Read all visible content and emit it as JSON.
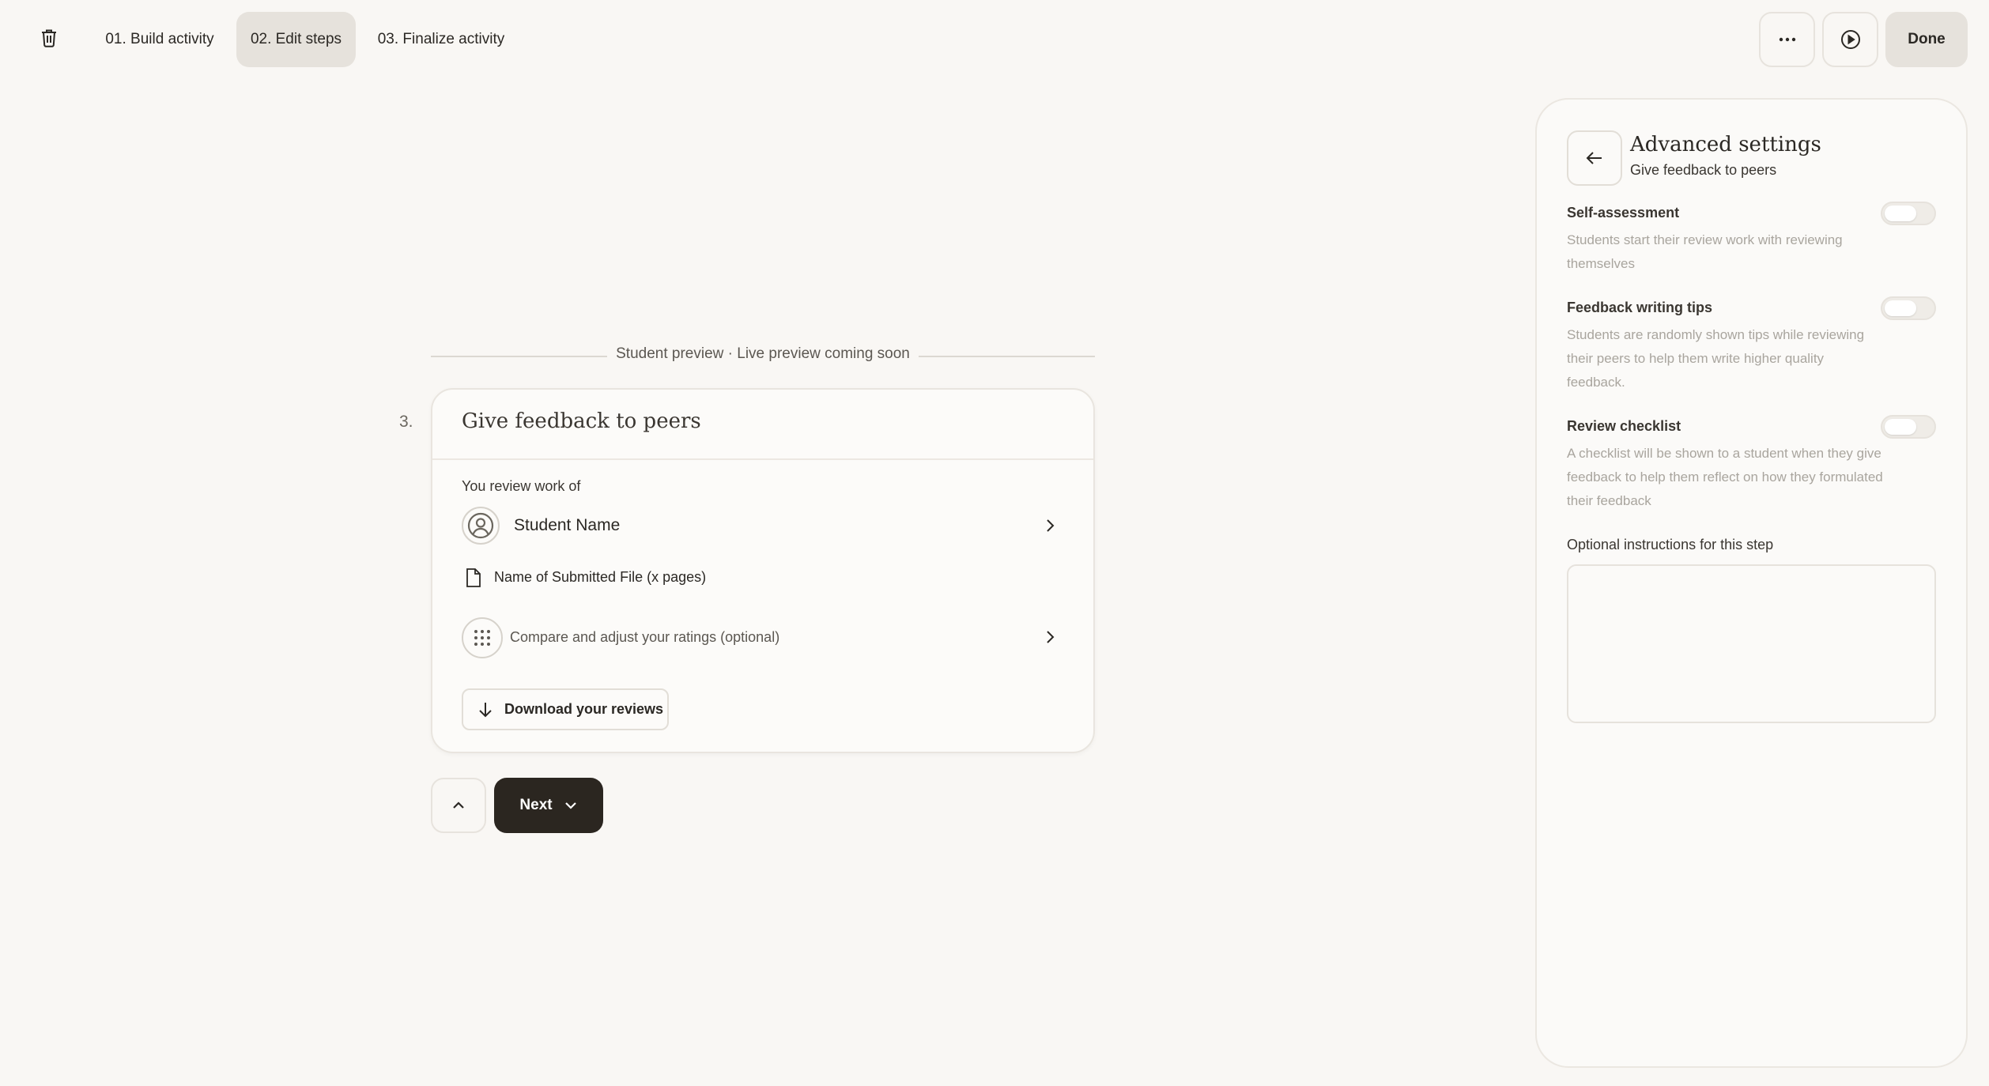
{
  "header": {
    "tabs": [
      {
        "label": "01. Build activity"
      },
      {
        "label": "02. Edit steps"
      },
      {
        "label": "03. Finalize activity"
      }
    ],
    "done_label": "Done",
    "icons": {
      "trash": "trash-icon",
      "more": "more-horizontal-icon",
      "preview": "play-circle-icon"
    }
  },
  "preview": {
    "label": "Student preview · Live preview coming soon",
    "step_number": "3.",
    "card": {
      "title": "Give feedback to peers",
      "review_label": "You review work of",
      "student_name": "Student Name",
      "file_name": "Name of Submitted File (x pages)",
      "ratings_label": "Compare and adjust your ratings (optional)",
      "download_label": "Download your reviews"
    },
    "next_label": "Next"
  },
  "panel": {
    "title": "Advanced settings",
    "subtitle": "Give feedback to peers",
    "settings": [
      {
        "label": "Self-assessment",
        "description": "Students start their review work with reviewing themselves",
        "enabled": false
      },
      {
        "label": "Feedback writing tips",
        "description": "Students are randomly shown tips while reviewing their peers to help them write higher quality feedback.",
        "enabled": false
      },
      {
        "label": "Review checklist",
        "description": "A checklist will be shown to a student when they give feedback to help them reflect on how they formulated their feedback",
        "enabled": false
      }
    ],
    "instructions_label": "Optional instructions for this step",
    "instructions_value": ""
  },
  "colors": {
    "background": "#f9f7f4",
    "primary_button": "#2b2620",
    "active_tab": "#e6e2dc"
  }
}
